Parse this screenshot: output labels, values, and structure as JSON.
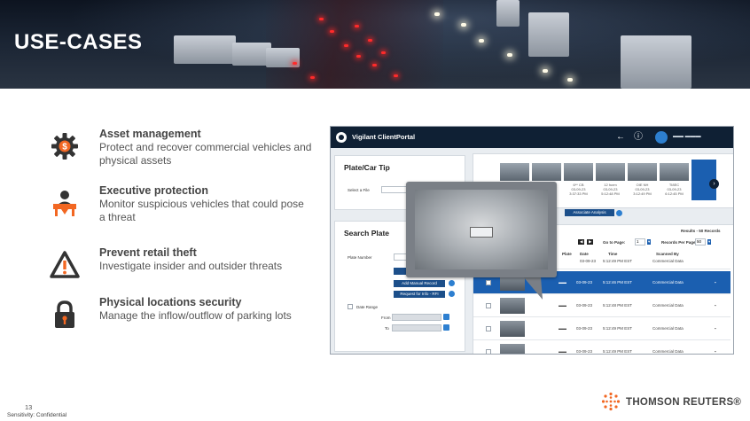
{
  "slide": {
    "title": "USE-CASES",
    "page_number": "13",
    "sensitivity": "Sensitivity: Confidential",
    "brand": "THOMSON REUTERS®"
  },
  "use_cases": [
    {
      "title": "Asset management",
      "description": "Protect and recover commercial vehicles and physical assets",
      "icon": "gear-dollar-icon"
    },
    {
      "title": "Executive protection",
      "description": "Monitor suspicious vehicles that could pose a threat",
      "icon": "executive-person-icon"
    },
    {
      "title": "Prevent retail theft",
      "description": "Investigate insider and outsider threats",
      "icon": "warning-triangle-icon"
    },
    {
      "title": "Physical locations security",
      "description": "Manage the inflow/outflow of parking lots",
      "icon": "padlock-icon"
    }
  ],
  "colors": {
    "accent": "#f26722",
    "icon_dark": "#333333",
    "portal_header": "#0f2034",
    "selected_row": "#1b5fb0"
  },
  "portal": {
    "app_name": "Vigilant ClientPortal",
    "plate_car_tip": {
      "title": "Plate/Car Tip",
      "select_file_label": "Select a File"
    },
    "search_plate": {
      "title": "Search Plate",
      "plate_number_label": "Plate Number",
      "add_manual_record": "Add Manual Record",
      "request_for_info": "Request for Info - RFI",
      "date_range_label": "Date Range",
      "from_label": "From",
      "to_label": "To"
    },
    "thumbnails": [
      {
        "line1": "6** CB",
        "line2": "03-09-23",
        "line3": "3:37:33 PM"
      },
      {
        "line1": "12 hcrm",
        "line2": "03-09-23",
        "line3": "5:12:48 PM"
      },
      {
        "line1": "OIE NH",
        "line2": "03-09-23",
        "line3": "3:12:49 PM"
      },
      {
        "line1": "TI8EC",
        "line2": "03-09-23",
        "line3": "6:12:45 PM"
      }
    ],
    "associate_analysis": "Associate Analysis",
    "results_label": "Results - 50 Records",
    "go_to_page_label": "Go to Page:",
    "go_to_page_value": "1",
    "records_per_page_label": "Records Per Page:",
    "records_per_page_value": "50",
    "columns": [
      "Plate",
      "Date",
      "Time",
      "Scanned By"
    ],
    "rows": [
      {
        "date": "03-09-23",
        "time": "5:12:49 PM EST",
        "scanned_by": "Commercial Data"
      },
      {
        "date": "03-09-23",
        "time": "5:12:46 PM EST",
        "scanned_by": "Commercial Data"
      },
      {
        "date": "03-09-23",
        "time": "5:12:48 PM EST",
        "scanned_by": "Commercial Data"
      },
      {
        "date": "03-09-23",
        "time": "5:12:49 PM EST",
        "scanned_by": "Commercial Data"
      },
      {
        "date": "03-09-23",
        "time": "5:12:49 PM EST",
        "scanned_by": "Commercial Data"
      }
    ]
  }
}
